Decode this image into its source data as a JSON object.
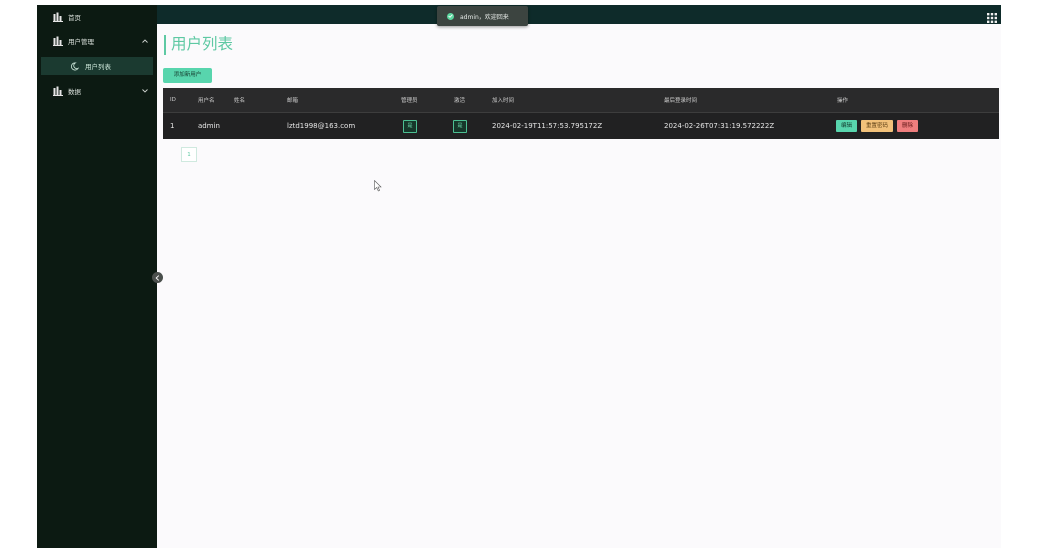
{
  "sidebar": {
    "items": [
      {
        "label": "首页",
        "icon": "chart-icon"
      },
      {
        "label": "用户管理",
        "icon": "chart-icon",
        "expanded": true
      },
      {
        "label": "用户列表",
        "icon": "moon-icon",
        "active": true
      },
      {
        "label": "数据",
        "icon": "chart-icon",
        "expanded": false
      }
    ]
  },
  "toast": {
    "message": "admin，欢迎回来"
  },
  "page": {
    "title": "用户列表",
    "add_button": "添加新用户"
  },
  "table": {
    "columns": [
      "ID",
      "用户名",
      "姓名",
      "邮箱",
      "管理员",
      "激活",
      "加入时间",
      "最后登录时间",
      "操作"
    ],
    "rows": [
      {
        "id": "1",
        "username": "admin",
        "name": "",
        "email": "lztd1998@163.com",
        "admin": "是",
        "active": "是",
        "joined": "2024-02-19T11:57:53.795172Z",
        "last_login": "2024-02-26T07:31:19.572222Z",
        "actions": [
          "编辑",
          "重置密码",
          "删除"
        ]
      }
    ]
  },
  "pagination": {
    "current": "1"
  },
  "colors": {
    "accent": "#5ec9a3",
    "sidebar": "#0c1a12",
    "table_bg": "#2a2a2b",
    "reset": "#f2c17a",
    "delete": "#ef7e7e"
  }
}
